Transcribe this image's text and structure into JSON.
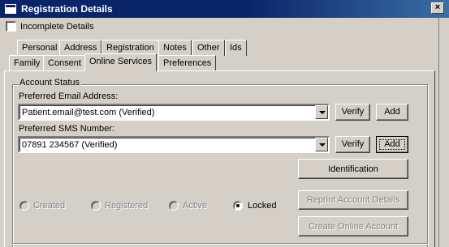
{
  "window": {
    "title": "Registration Details",
    "close_glyph": "×"
  },
  "incomplete_details": {
    "label": "Incomplete Details",
    "checked": false
  },
  "tabs_row1": [
    {
      "label": "Personal"
    },
    {
      "label": "Address"
    },
    {
      "label": "Registration"
    },
    {
      "label": "Notes"
    },
    {
      "label": "Other"
    },
    {
      "label": "Ids"
    }
  ],
  "tabs_row2": [
    {
      "label": "Family"
    },
    {
      "label": "Consent"
    },
    {
      "label": "Online Services",
      "active": true
    },
    {
      "label": "Preferences"
    }
  ],
  "account_status": {
    "group_title": "Account Status",
    "email_label": "Preferred Email Address:",
    "email_value": "Patient.email@test.com (Verified)",
    "sms_label": "Preferred SMS Number:",
    "sms_value": "07891 234567 (Verified)",
    "verify_label": "Verify",
    "add_label": "Add",
    "identification_label": "Identification",
    "reprint_label": "Reprint Account Details",
    "create_label": "Create Online Account",
    "statuses": [
      {
        "label": "Created",
        "checked": false,
        "enabled": false
      },
      {
        "label": "Registered",
        "checked": false,
        "enabled": false
      },
      {
        "label": "Active",
        "checked": false,
        "enabled": false
      },
      {
        "label": "Locked",
        "checked": true,
        "enabled": true
      }
    ]
  }
}
